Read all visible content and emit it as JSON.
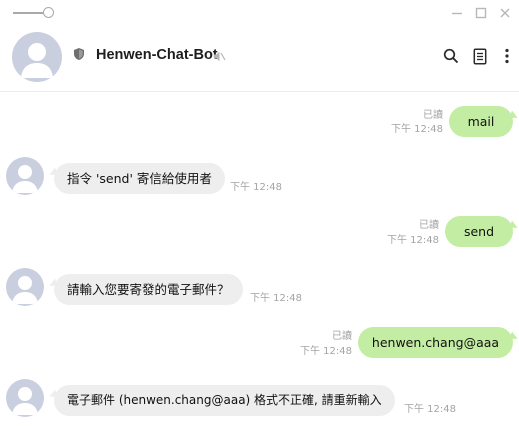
{
  "window": {
    "controls": {
      "minimize_icon": "minimize-icon",
      "maximize_icon": "maximize-icon",
      "close_icon": "close-icon"
    }
  },
  "header": {
    "title": "Henwen-Chat-Bot",
    "icons": [
      "shield-icon",
      "mute-icon",
      "search-icon",
      "notes-icon",
      "more-icon"
    ]
  },
  "messages": [
    {
      "direction": "out",
      "text": "mail",
      "read": "已讀",
      "time": "下午 12:48"
    },
    {
      "direction": "in",
      "text": "指令 'send' 寄信給使用者",
      "time": "下午 12:48"
    },
    {
      "direction": "out",
      "text": "send",
      "read": "已讀",
      "time": "下午 12:48"
    },
    {
      "direction": "in",
      "text": "請輸入您要寄發的電子郵件？",
      "time": "下午 12:48"
    },
    {
      "direction": "out",
      "text": "henwen.chang@aaa",
      "read": "已讀",
      "time": "下午 12:48"
    },
    {
      "direction": "in",
      "text": "電子郵件 (henwen.chang@aaa) 格式不正確, 請重新輸入",
      "time": "下午 12:48"
    }
  ],
  "colors": {
    "outgoing_bubble": "#c4eda4",
    "incoming_bubble": "#eeeeee",
    "meta_text": "#a4a4a4"
  }
}
